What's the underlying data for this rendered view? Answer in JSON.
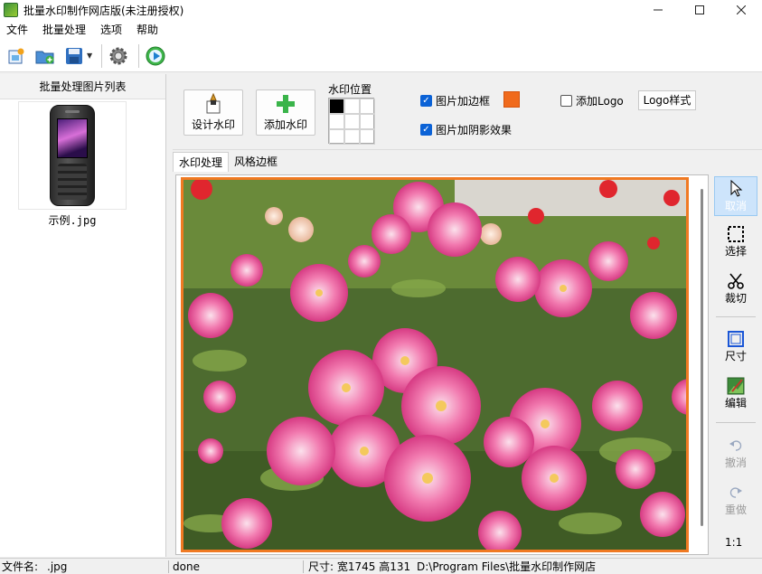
{
  "window": {
    "title": "批量水印制作网店版(未注册授权)"
  },
  "menu": [
    "文件",
    "批量处理",
    "选项",
    "帮助"
  ],
  "toolbar": {
    "icons": [
      "new-project-icon",
      "open-folder-icon",
      "save-icon",
      "settings-gear-icon",
      "play-start-icon"
    ]
  },
  "left_panel": {
    "header": "批量处理图片列表",
    "thumbnails": [
      {
        "filename": "示例.jpg"
      }
    ]
  },
  "watermark_bar": {
    "design_button": "设计水印",
    "add_button": "添加水印",
    "position_label": "水印位置",
    "position_selected_index": 0,
    "border_checkbox": {
      "label": "图片加边框",
      "checked": true,
      "color": "#f06a1c"
    },
    "shadow_checkbox": {
      "label": "图片加阴影效果",
      "checked": true
    },
    "logo_checkbox": {
      "label": "添加Logo",
      "checked": false
    },
    "logo_style_button": "Logo样式"
  },
  "tabs": [
    {
      "label": "水印处理",
      "active": true
    },
    {
      "label": "风格边框",
      "active": false
    }
  ],
  "side_tools": {
    "cancel": "取消",
    "select": "选择",
    "crop": "裁切",
    "size": "尺寸",
    "edit": "编辑",
    "undo": "撤消",
    "redo": "重做",
    "zoom_ratio": "1:1"
  },
  "status": {
    "filename_label": "文件名:",
    "filename_value": ".jpg",
    "state": "done",
    "dimensions": "尺寸: 宽1745 高131",
    "path": "D:\\Program Files\\批量水印制作网店"
  },
  "colors": {
    "accent": "#0b62d6",
    "border_color": "#f06a1c"
  }
}
